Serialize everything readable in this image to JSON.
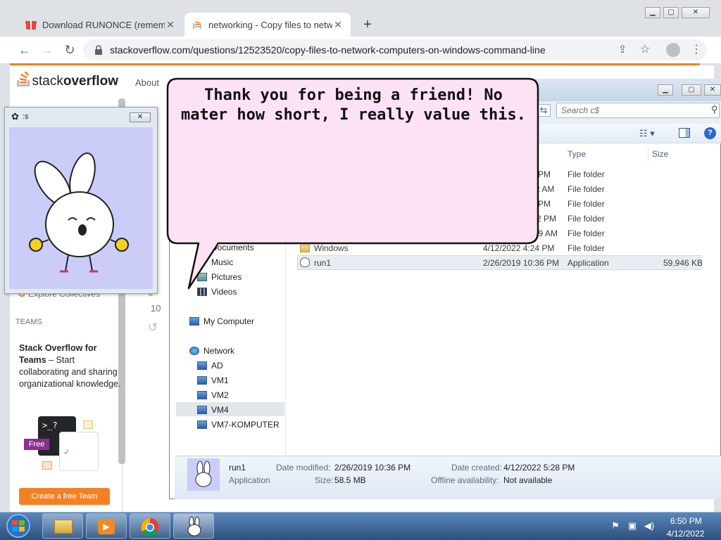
{
  "browser": {
    "tabs": [
      {
        "title": "Download RUNONCE (remembe",
        "close": "✕"
      },
      {
        "title": "networking - Copy files to netwo",
        "close": "✕"
      }
    ],
    "new_tab": "+",
    "address": "stackoverflow.com/questions/12523520/copy-files-to-network-computers-on-windows-command-line",
    "window_controls": [
      "▁",
      "▢",
      "✕"
    ]
  },
  "stackoverflow": {
    "logo_light": "stack",
    "logo_bold": "overflow",
    "nav_about": "About",
    "sidebar": {
      "explore_collectives": "Explore Collectives",
      "teams_label": "TEAMS",
      "teams_title": "Stack Overflow for Teams",
      "teams_desc": " – Start collaborating and sharing organizational knowledge.",
      "free_badge": "Free",
      "create_team_button": "Create a free Team"
    },
    "vote_count": "10"
  },
  "pet_window": {
    "title": ":s",
    "close": "✕"
  },
  "speech_bubble": {
    "text": "Thank you for being a friend! No mater how short, I really value this."
  },
  "explorer": {
    "search_placeholder": "Search c$",
    "columns": [
      "Type",
      "Size"
    ],
    "nav": {
      "documents": "Documents",
      "music": "Music",
      "pictures": "Pictures",
      "videos": "Videos",
      "my_computer": "My Computer",
      "network": "Network",
      "network_items": [
        "AD",
        "VM1",
        "VM2",
        "VM4",
        "VM7-KOMPUTER"
      ]
    },
    "rows": [
      {
        "date": "PM",
        "type": "File folder",
        "size": ""
      },
      {
        "date": "2 AM",
        "type": "File folder",
        "size": ""
      },
      {
        "date": "PM",
        "type": "File folder",
        "size": ""
      },
      {
        "date": "2 PM",
        "type": "File folder",
        "size": ""
      },
      {
        "date": "09 AM",
        "type": "File folder",
        "size": ""
      },
      {
        "name": "Windows",
        "date": "4/12/2022 4:24 PM",
        "type": "File folder",
        "size": ""
      },
      {
        "name": "run1",
        "date": "2/26/2019 10:36 PM",
        "type": "Application",
        "size": "59,946 KB"
      }
    ],
    "details": {
      "name": "run1",
      "kind": "Application",
      "date_modified_label": "Date modified:",
      "date_modified": "2/26/2019 10:36 PM",
      "size_label": "Size:",
      "size": "58.5 MB",
      "date_created_label": "Date created:",
      "date_created": "4/12/2022 5:28 PM",
      "offline_label": "Offline availability:",
      "offline": "Not available"
    }
  },
  "taskbar": {
    "time": "6:50 PM",
    "date": "4/12/2022"
  },
  "colors": {
    "so_orange": "#f48024",
    "pet_bg": "#ccccf9",
    "bubble_fill": "#fde2f6"
  }
}
